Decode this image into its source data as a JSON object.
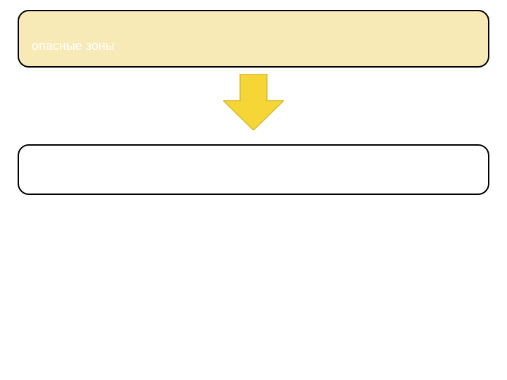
{
  "boxes": {
    "top": {
      "label": "опасные зоны"
    },
    "bottom": {
      "label": ""
    }
  },
  "arrow": {
    "fill": "#f5d636",
    "stroke": "#d9b92a"
  }
}
